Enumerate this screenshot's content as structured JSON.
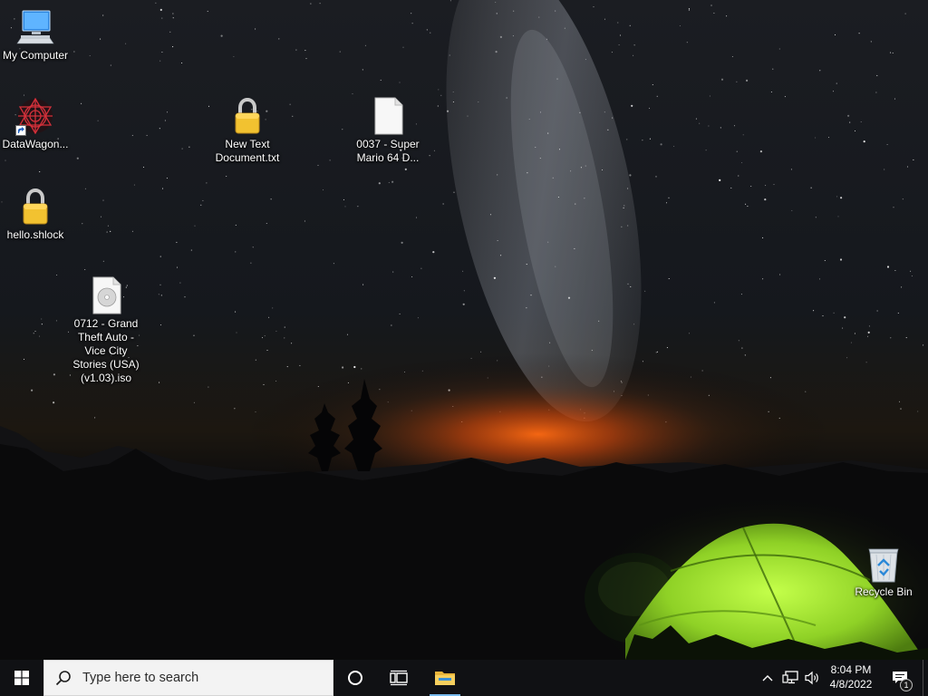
{
  "desktop": {
    "icons": [
      {
        "label": "My Computer",
        "icon": "computer-icon"
      },
      {
        "label": "DataWagon...",
        "icon": "datawagon-logo-icon",
        "shortcut": true
      },
      {
        "label": "hello.shlock",
        "icon": "padlock-icon"
      },
      {
        "label": "0712 - Grand Theft Auto - Vice City Stories (USA) (v1.03).iso",
        "icon": "disc-image-file-icon"
      },
      {
        "label": "New Text Document.txt",
        "icon": "padlock-icon"
      },
      {
        "label": "0037 - Super Mario 64 D...",
        "icon": "blank-file-icon"
      },
      {
        "label": "Recycle Bin",
        "icon": "recycle-bin-icon"
      }
    ]
  },
  "taskbar": {
    "search_placeholder": "Type here to search",
    "clock": {
      "time": "8:04 PM",
      "date": "4/8/2022"
    },
    "notification_count": "1"
  },
  "colors": {
    "taskbar_bg": "#101114",
    "search_bg": "#f3f3f3",
    "start_blue": "#ffffff",
    "accent": "#76b9ed",
    "tent_green": "#9be030",
    "padlock_gold": "#e9b52a"
  }
}
